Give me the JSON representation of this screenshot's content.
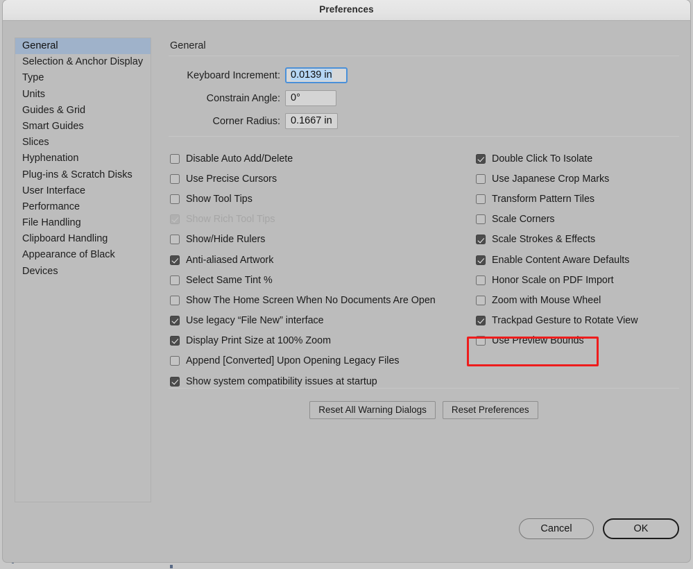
{
  "window": {
    "title": "Preferences"
  },
  "sidebar": {
    "items": [
      {
        "label": "General",
        "selected": true
      },
      {
        "label": "Selection & Anchor Display",
        "selected": false
      },
      {
        "label": "Type",
        "selected": false
      },
      {
        "label": "Units",
        "selected": false
      },
      {
        "label": "Guides & Grid",
        "selected": false
      },
      {
        "label": "Smart Guides",
        "selected": false
      },
      {
        "label": "Slices",
        "selected": false
      },
      {
        "label": "Hyphenation",
        "selected": false
      },
      {
        "label": "Plug-ins & Scratch Disks",
        "selected": false
      },
      {
        "label": "User Interface",
        "selected": false
      },
      {
        "label": "Performance",
        "selected": false
      },
      {
        "label": "File Handling",
        "selected": false
      },
      {
        "label": "Clipboard Handling",
        "selected": false
      },
      {
        "label": "Appearance of Black",
        "selected": false
      },
      {
        "label": "Devices",
        "selected": false
      }
    ]
  },
  "main": {
    "heading": "General",
    "fields": [
      {
        "label": "Keyboard Increment:",
        "value": "0.0139 in",
        "focused": true
      },
      {
        "label": "Constrain Angle:",
        "value": "0°",
        "focused": false
      },
      {
        "label": "Corner Radius:",
        "value": "0.1667 in",
        "focused": false
      }
    ],
    "checkboxes_left": [
      {
        "label": "Disable Auto Add/Delete",
        "checked": false,
        "disabled": false
      },
      {
        "label": "Use Precise Cursors",
        "checked": false,
        "disabled": false
      },
      {
        "label": "Show Tool Tips",
        "checked": false,
        "disabled": false
      },
      {
        "label": "Show Rich Tool Tips",
        "checked": true,
        "disabled": true
      },
      {
        "label": "Show/Hide Rulers",
        "checked": false,
        "disabled": false
      },
      {
        "label": "Anti-aliased Artwork",
        "checked": true,
        "disabled": false
      },
      {
        "label": "Select Same Tint %",
        "checked": false,
        "disabled": false
      },
      {
        "label": "Show The Home Screen When No Documents Are Open",
        "checked": false,
        "disabled": false
      },
      {
        "label": "Use legacy “File New” interface",
        "checked": true,
        "disabled": false
      },
      {
        "label": "Display Print Size at 100% Zoom",
        "checked": true,
        "disabled": false
      },
      {
        "label": "Append [Converted] Upon Opening Legacy Files",
        "checked": false,
        "disabled": false
      },
      {
        "label": "Show system compatibility issues at startup",
        "checked": true,
        "disabled": false
      }
    ],
    "checkboxes_right": [
      {
        "label": "Double Click To Isolate",
        "checked": true,
        "disabled": false
      },
      {
        "label": "Use Japanese Crop Marks",
        "checked": false,
        "disabled": false
      },
      {
        "label": "Transform Pattern Tiles",
        "checked": false,
        "disabled": false
      },
      {
        "label": "Scale Corners",
        "checked": false,
        "disabled": false
      },
      {
        "label": "Scale Strokes & Effects",
        "checked": true,
        "disabled": false
      },
      {
        "label": "Enable Content Aware Defaults",
        "checked": true,
        "disabled": false
      },
      {
        "label": "Honor Scale on PDF Import",
        "checked": false,
        "disabled": false
      },
      {
        "label": "Zoom with Mouse Wheel",
        "checked": false,
        "disabled": false
      },
      {
        "label": "Trackpad Gesture to Rotate View",
        "checked": true,
        "disabled": false
      },
      {
        "label": "Use Preview Bounds",
        "checked": false,
        "disabled": false,
        "highlighted": true
      }
    ],
    "reset_buttons": [
      {
        "label": "Reset All Warning Dialogs"
      },
      {
        "label": "Reset Preferences"
      }
    ]
  },
  "footer": {
    "cancel_label": "Cancel",
    "ok_label": "OK"
  },
  "annotation": {
    "color": "#ee1c1c",
    "target": "Use Preview Bounds"
  }
}
